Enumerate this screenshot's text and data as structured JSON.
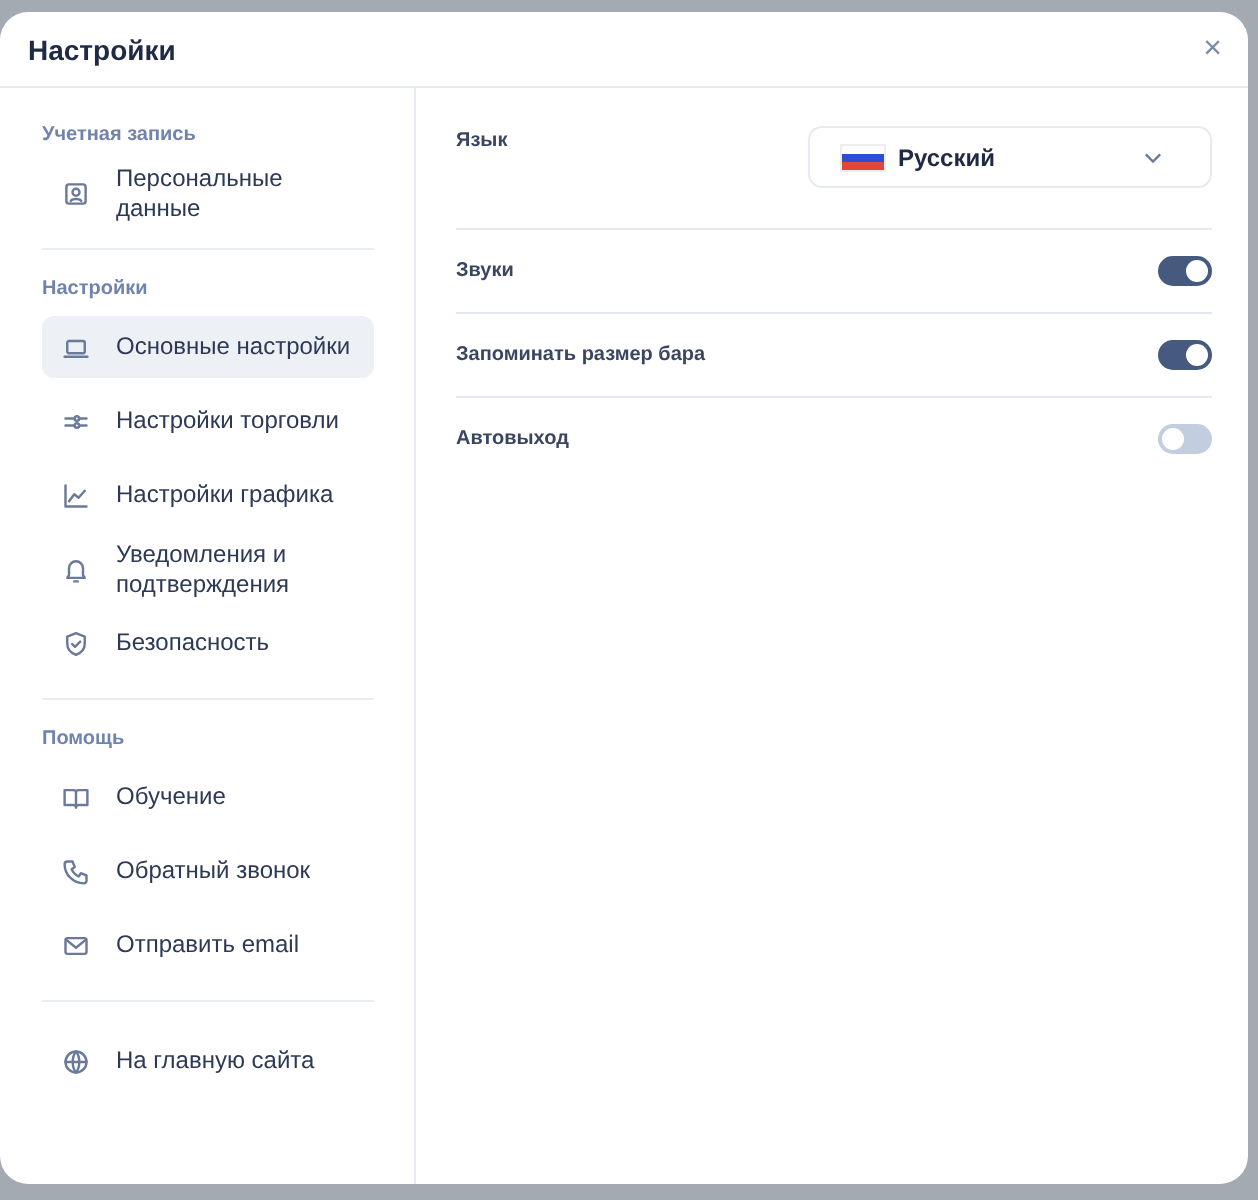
{
  "window": {
    "title": "Настройки",
    "close": "×"
  },
  "sidebar": {
    "sections": [
      {
        "heading": "Учетная запись",
        "items": [
          {
            "label": "Персональные данные",
            "selected": false
          }
        ]
      },
      {
        "heading": "Настройки",
        "items": [
          {
            "label": "Основные настройки",
            "selected": true
          },
          {
            "label": "Настройки торговли",
            "selected": false
          },
          {
            "label": "Настройки графика",
            "selected": false
          },
          {
            "label": "Уведомления и подтверждения",
            "selected": false
          },
          {
            "label": "Безопасность",
            "selected": false
          }
        ]
      },
      {
        "heading": "Помощь",
        "items": [
          {
            "label": "Обучение",
            "selected": false
          },
          {
            "label": "Обратный звонок",
            "selected": false
          },
          {
            "label": "Отправить email",
            "selected": false
          }
        ]
      },
      {
        "items": [
          {
            "label": "На главную сайта",
            "selected": false
          }
        ]
      }
    ]
  },
  "settings": [
    {
      "kind": "select",
      "label": "Язык",
      "value": "Русский"
    },
    {
      "kind": "toggle",
      "label": "Звуки",
      "on": true
    },
    {
      "kind": "toggle",
      "label": "Запоминать размер бара",
      "on": true
    },
    {
      "kind": "toggle",
      "label": "Автовыход",
      "on": false
    }
  ]
}
